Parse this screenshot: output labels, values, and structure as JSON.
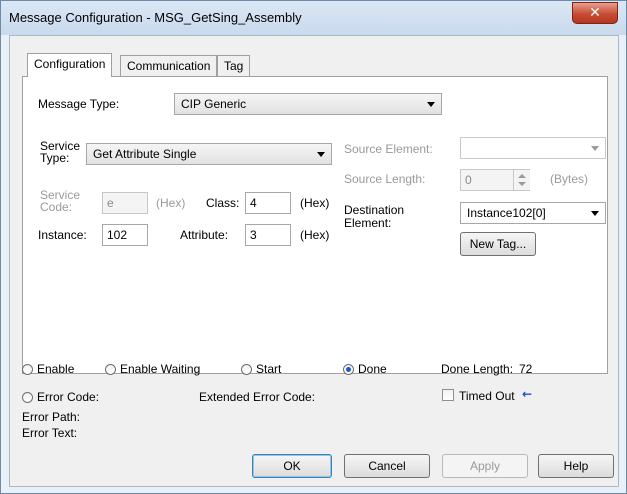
{
  "window": {
    "title": "Message Configuration - MSG_GetSing_Assembly"
  },
  "tabs": [
    {
      "label": "Configuration",
      "active": true
    },
    {
      "label": "Communication",
      "active": false
    },
    {
      "label": "Tag",
      "active": false
    }
  ],
  "config": {
    "message_type_label": "Message Type:",
    "message_type_value": "CIP Generic",
    "service_type_label_1": "Service",
    "service_type_label_2": "Type:",
    "service_type_value": "Get Attribute Single",
    "service_code_label_1": "Service",
    "service_code_label_2": "Code:",
    "service_code_value": "e",
    "service_code_unit": "(Hex)",
    "class_label": "Class:",
    "class_value": "4",
    "class_unit": "(Hex)",
    "instance_label": "Instance:",
    "instance_value": "102",
    "attribute_label": "Attribute:",
    "attribute_value": "3",
    "attribute_unit": "(Hex)",
    "source_element_label": "Source Element:",
    "source_element_value": "",
    "source_length_label": "Source Length:",
    "source_length_value": "0",
    "source_length_unit": "(Bytes)",
    "destination_label_1": "Destination",
    "destination_label_2": "Element:",
    "destination_value": "Instance102[0]",
    "new_tag_label": "New Tag..."
  },
  "status": {
    "enable": "Enable",
    "enable_waiting": "Enable Waiting",
    "start": "Start",
    "done": "Done",
    "done_selected": true,
    "done_length_label": "Done Length:",
    "done_length_value": "72",
    "error_code_label": "Error Code:",
    "extended_error_label": "Extended Error Code:",
    "timed_out_label": "Timed Out",
    "timed_out_arrow": "←",
    "error_path_label": "Error Path:",
    "error_text_label": "Error Text:"
  },
  "buttons": {
    "ok": "OK",
    "cancel": "Cancel",
    "apply": "Apply",
    "help": "Help"
  },
  "icons": {
    "close": "close-icon",
    "dropdown": "chevron-down-icon",
    "spinner": "spinner-icon",
    "timed_out_arrow_color": "#1a4fd1"
  }
}
